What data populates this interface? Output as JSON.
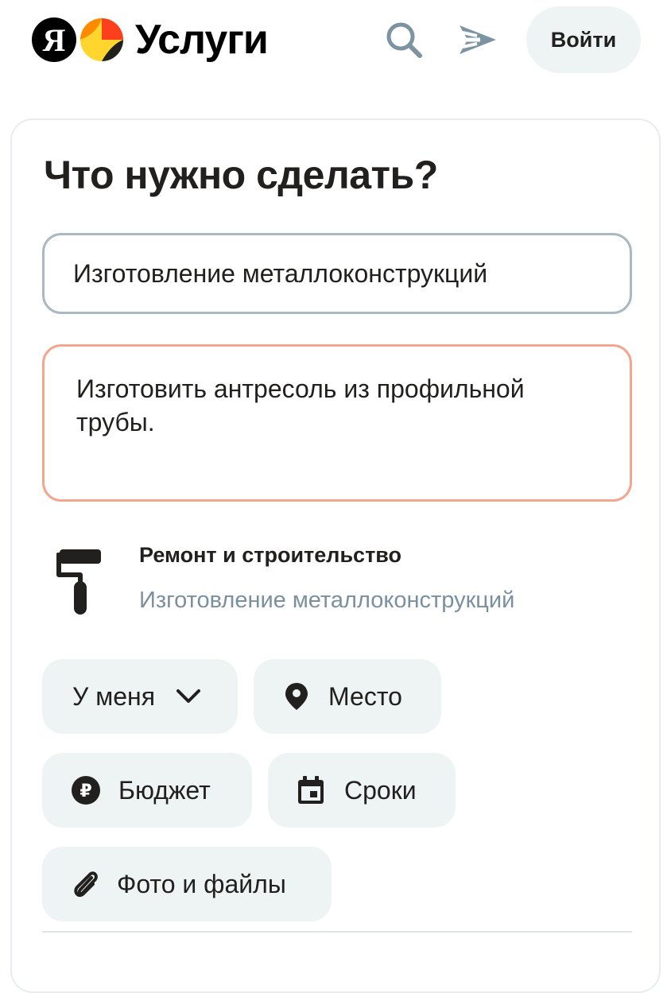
{
  "header": {
    "logo_letter": "Я",
    "logo_text": "Услуги",
    "login_label": "Войти",
    "icons": [
      "search-icon",
      "send-icon"
    ]
  },
  "form": {
    "title": "Что нужно сделать?",
    "service_value": "Изготовление металлоконструкций",
    "description_value": "Изготовить антресоль из профильной трубы.",
    "category": {
      "name": "Ремонт и строительство",
      "subcategory": "Изготовление металлоконструкций",
      "icon": "paint-roller-icon"
    },
    "chips": {
      "location_mode": "У меня",
      "place": "Место",
      "budget": "Бюджет",
      "deadline": "Сроки",
      "attachments": "Фото и файлы"
    }
  },
  "colors": {
    "brand_accent": "#fc3f1d",
    "chip_bg": "#eef4f3",
    "input_border": "#a9b8c2",
    "textarea_border": "#f4a58d",
    "muted_text": "#7a90a0"
  }
}
